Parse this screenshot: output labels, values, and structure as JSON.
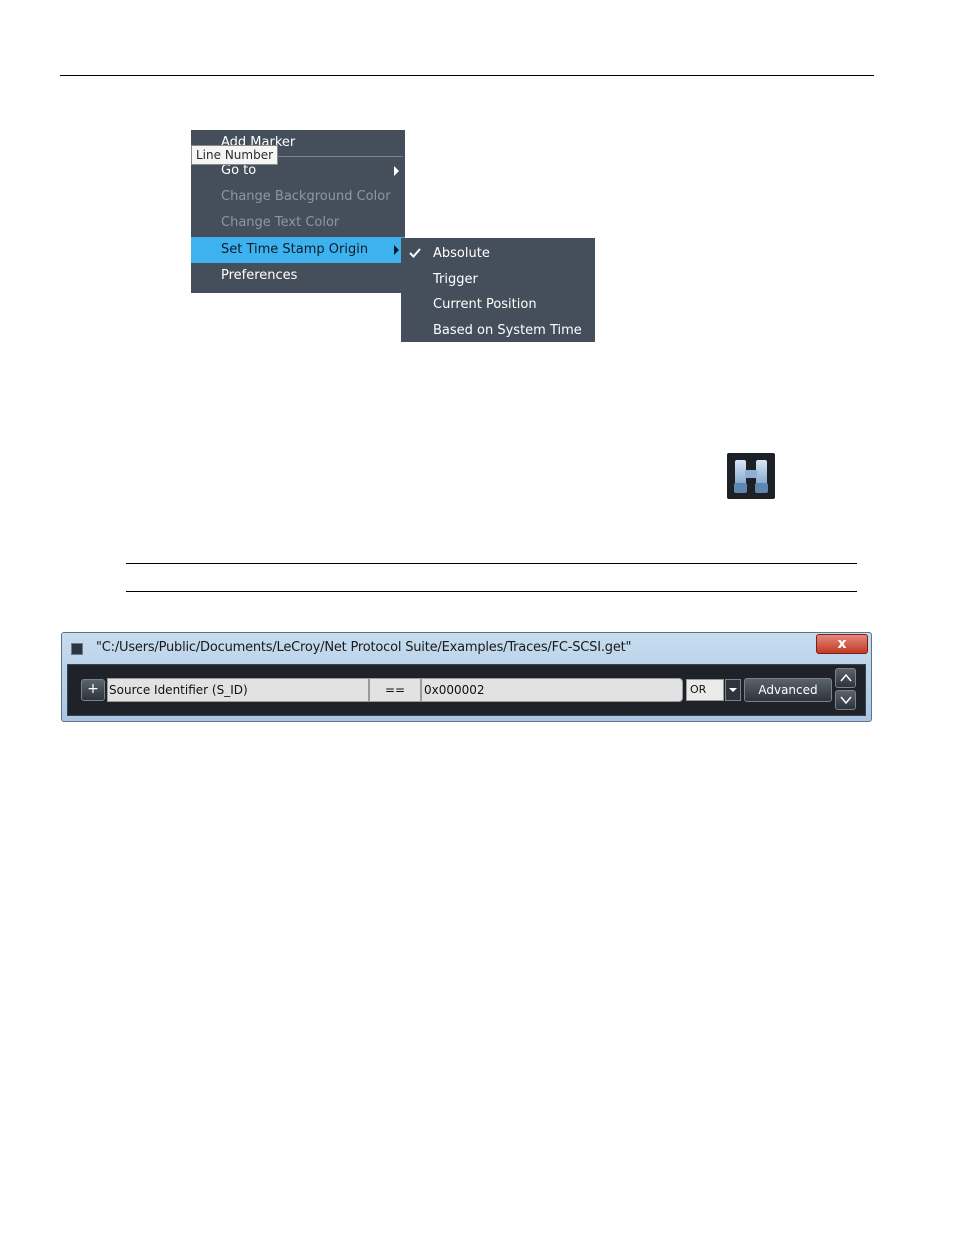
{
  "context_menu": {
    "items": [
      {
        "label": "Add Marker"
      },
      {
        "label": "Go to"
      },
      {
        "label": "Change Background Color"
      },
      {
        "label": "Change Text Color"
      },
      {
        "label": "Set Time Stamp Origin"
      },
      {
        "label": "Preferences"
      }
    ],
    "tooltip": "Line Number",
    "highlight_color": "#3db2ef",
    "background_color": "#454f5b"
  },
  "submenu": {
    "items": [
      {
        "label": "Absolute",
        "checked": true
      },
      {
        "label": "Trigger"
      },
      {
        "label": "Current Position"
      },
      {
        "label": "Based on System Time"
      }
    ]
  },
  "icons": {
    "search": "binoculars-icon"
  },
  "search_window": {
    "title": "\"C:/Users/Public/Documents/LeCroy/Net Protocol Suite/Examples/Traces/FC-SCSI.get\"",
    "close_label": "x",
    "add_label": "+",
    "field": "Source Identifier (S_ID)",
    "operator": "==",
    "value": "0x000002",
    "logic": "OR",
    "advanced_label": "Advanced"
  }
}
